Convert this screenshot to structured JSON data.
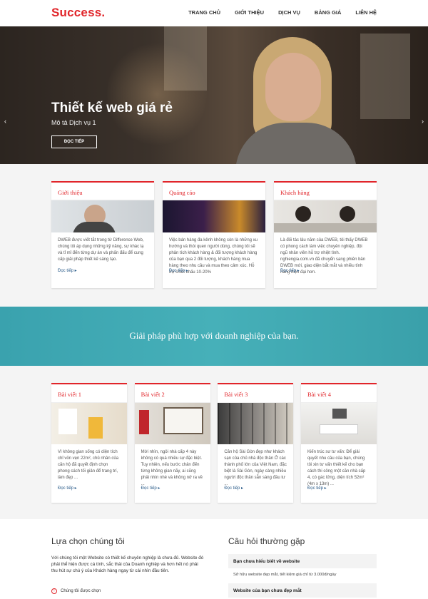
{
  "header": {
    "logo": "Success.",
    "nav": [
      "TRANG CHỦ",
      "GIỚI THIỆU",
      "DỊCH VỤ",
      "BẢNG GIÁ",
      "LIÊN HỆ"
    ]
  },
  "hero": {
    "title": "Thiết kế web giá rẻ",
    "subtitle": "Mô tả Dịch vụ 1",
    "button": "ĐỌC TIẾP",
    "prev": "‹",
    "next": "›"
  },
  "services": [
    {
      "title": "Giới thiệu",
      "text": "DWEB được viết tắt trong từ Difference Web, chúng tôi áp dụng những kỹ năng, sự khác lạ và tỉ mỉ đến từng dự án và phấn đấu để cung cấp giải pháp thiết kế sáng tạo.",
      "more": "Đọc tiếp ▸"
    },
    {
      "title": "Quảng cáo",
      "text": "Việc bán hàng đa kênh không còn là những xu hướng và thói quen người dùng, chúng tôi sẽ phân tích khách hàng & đối tượng khách hàng của bạn qua 2 đối tượng, khách hàng mua hàng theo nhu cầu và mua theo cảm xúc. Hỗ trợ chiết khấu 10-20%",
      "more": "Đọc tiếp ▸"
    },
    {
      "title": "Khách hàng",
      "text": "Là đối tác lâu năm của DWEB, tôi thấy DWEB có phong cách làm việc chuyên nghiệp, đội ngũ nhân viên hỗ trợ nhiệt tình. nghiengia.com.vn đã chuyển sang phiên bản DWEB mới, giao diện bắt mắt và nhiều tính năng hiện đại hơn.",
      "more": "Đọc tiếp ▸"
    }
  ],
  "banner": {
    "text": "Giải pháp phù hợp với doanh nghiệp của bạn."
  },
  "posts": [
    {
      "title": "Bài viết 1",
      "text": "Vì không gian sống có diện tích chỉ vỏn vẹn 22m², chủ nhân của căn hộ đã quyết định chọn phong cách tối giản để trang trí, làm đẹp ...",
      "more": "Đọc tiếp ▸"
    },
    {
      "title": "Bài viết 2",
      "text": "Mới nhìn, ngôi nhà cấp 4 này không có quá nhiều sự đặc biệt. Tuy nhiên, nếu bước chân đến từng không gian nãy, ai cũng phải nhìn nhé và không nở ra về ...",
      "more": "Đọc tiếp ▸"
    },
    {
      "title": "Bài viết 3",
      "text": "Căn hộ Sài Gòn đẹp như khách sạn của chủ nhà độc thân Ở các thành phố lớn của Việt Nam, đặc biệt là Sài Gòn, ngày càng nhiều người độc thân sẵn sàng đầu tư ...",
      "more": "Đọc tiếp ▸"
    },
    {
      "title": "Bài viết 4",
      "text": "Kiến trúc sư tư vấn: Để giải quyết nhu cầu của bạn, chúng tôi xin tư vấn thiết kế cho bạn cách thi công một căn nhà cấp 4, có gác lửng, diện tích 52m² (4m x 13m) ...",
      "more": "Đọc tiếp ▸"
    }
  ],
  "why": {
    "title": "Lựa chọn chúng tôi",
    "text": "Với chúng tôi một Website có thiết kế chuyên nghiệp là chưa đủ. Website đó phải thể hiện được cá tính, sắc thái của Doanh nghiệp và hơn hết nó phải thu hút sự chú ý của Khách hàng ngay từ cái nhìn đầu tiên.",
    "item": "Chúng tôi được chọn",
    "item_icon": "!"
  },
  "faq": {
    "title": "Câu hỏi thường gặp",
    "q1": "Bạn chưa hiểu biết về website",
    "a1": "Sở hữu website đẹp mắt, tiết kiệm giá chỉ từ 3.000đ/ngày",
    "q2": "Website của bạn chưa đẹp mắt"
  },
  "colors": {
    "accent": "#e1252a",
    "banner": "#40a9b4",
    "link": "#2b5c8a"
  }
}
